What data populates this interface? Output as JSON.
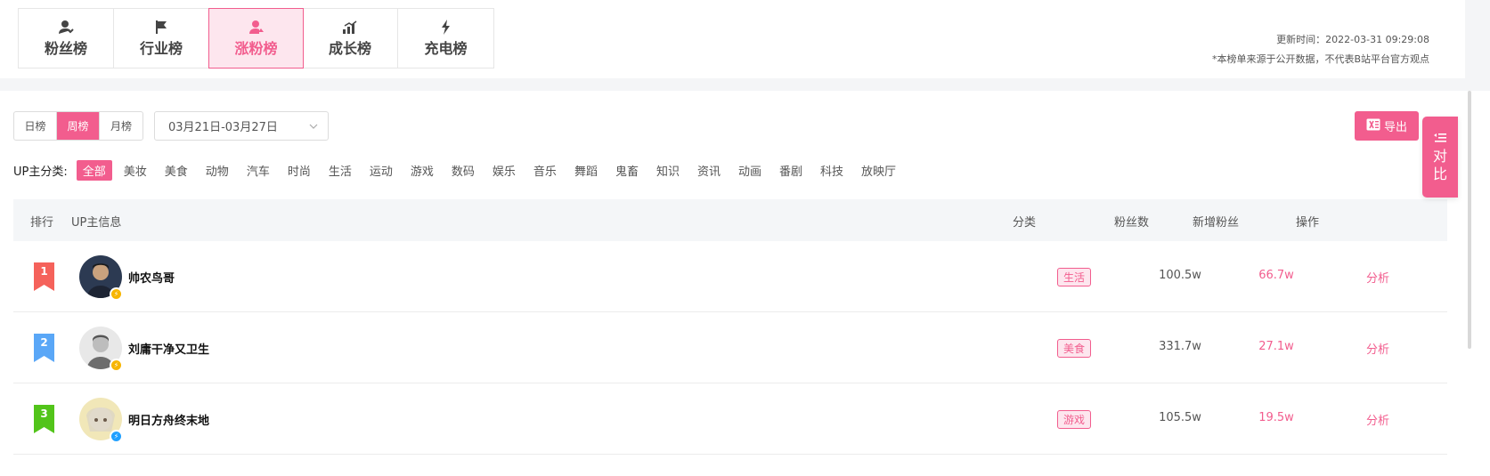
{
  "rank_tabs": [
    {
      "label": "粉丝榜",
      "icon": "user-heart-icon",
      "active": false
    },
    {
      "label": "行业榜",
      "icon": "flag-icon",
      "active": false
    },
    {
      "label": "涨粉榜",
      "icon": "user-up-icon",
      "active": true
    },
    {
      "label": "成长榜",
      "icon": "growth-bars-icon",
      "active": false
    },
    {
      "label": "充电榜",
      "icon": "lightning-icon",
      "active": false
    }
  ],
  "update_info": {
    "time": "更新时间：2022-03-31 09:29:08",
    "note": "*本榜单来源于公开数据，不代表B站平台官方观点"
  },
  "periods": [
    "日榜",
    "周榜",
    "月榜"
  ],
  "active_period": "周榜",
  "date_range": "03月21日-03月27日",
  "export_label": "导出",
  "category_label": "UP主分类:",
  "categories": [
    "全部",
    "美妆",
    "美食",
    "动物",
    "汽车",
    "时尚",
    "生活",
    "运动",
    "游戏",
    "数码",
    "娱乐",
    "音乐",
    "舞蹈",
    "鬼畜",
    "知识",
    "资讯",
    "动画",
    "番剧",
    "科技",
    "放映厅"
  ],
  "active_category": "全部",
  "table": {
    "headers": {
      "rank": "排行",
      "info": "UP主信息",
      "category": "分类",
      "fans": "粉丝数",
      "new_fans": "新增粉丝",
      "action": "操作"
    },
    "rows": [
      {
        "rank": "1",
        "name": "帅农鸟哥",
        "category": "生活",
        "fans": "100.5w",
        "new_fans": "66.7w",
        "action": "分析"
      },
      {
        "rank": "2",
        "name": "刘庸干净又卫生",
        "category": "美食",
        "fans": "331.7w",
        "new_fans": "27.1w",
        "action": "分析"
      },
      {
        "rank": "3",
        "name": "明日方舟终末地",
        "category": "游戏",
        "fans": "105.5w",
        "new_fans": "19.5w",
        "action": "分析"
      }
    ]
  },
  "compare_label_1": "对",
  "compare_label_2": "比",
  "colors": {
    "accent": "#f25d8e",
    "rank1": "#f5625b",
    "rank2": "#5aa7f7",
    "rank3": "#52c41a",
    "verify_yellow": "#f7b500",
    "verify_blue": "#20a0ff"
  }
}
